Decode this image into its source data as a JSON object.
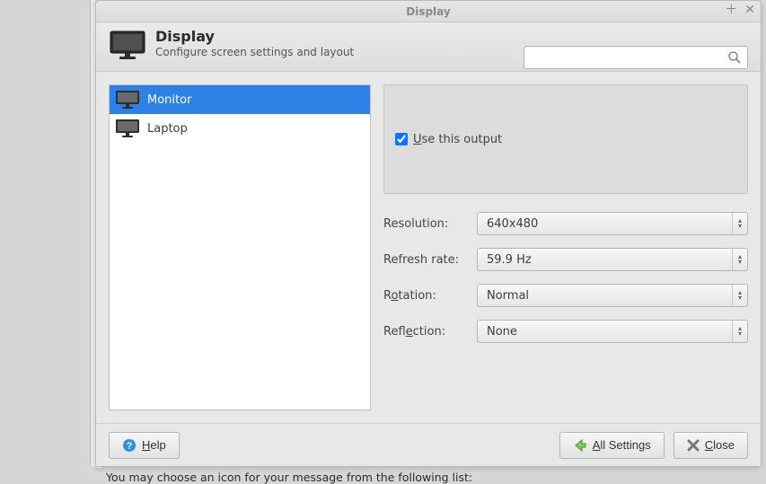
{
  "window": {
    "title": "Display"
  },
  "header": {
    "title": "Display",
    "subtitle": "Configure screen settings and layout"
  },
  "search": {
    "placeholder": ""
  },
  "outputs": [
    {
      "label": "Monitor",
      "selected": true
    },
    {
      "label": "Laptop",
      "selected": false
    }
  ],
  "use_output": {
    "label_prefix": "U",
    "label_rest": "se this output",
    "checked": true
  },
  "settings": {
    "resolution": {
      "label": "Resolution:",
      "value": "640x480"
    },
    "refresh": {
      "label": "Refresh rate:",
      "value": "59.9 Hz"
    },
    "rotation": {
      "label_prefix": "R",
      "label_u": "o",
      "label_rest": "tation:",
      "value": "Normal"
    },
    "reflection": {
      "label_prefix": "Refl",
      "label_u": "e",
      "label_rest": "ction:",
      "value": "None"
    }
  },
  "footer": {
    "help_u": "H",
    "help_rest": "elp",
    "all_u": "A",
    "all_rest": "ll Settings",
    "close_u": "C",
    "close_rest": "lose"
  },
  "behind": {
    "hint": "You may choose an icon for your message from the following list:"
  }
}
